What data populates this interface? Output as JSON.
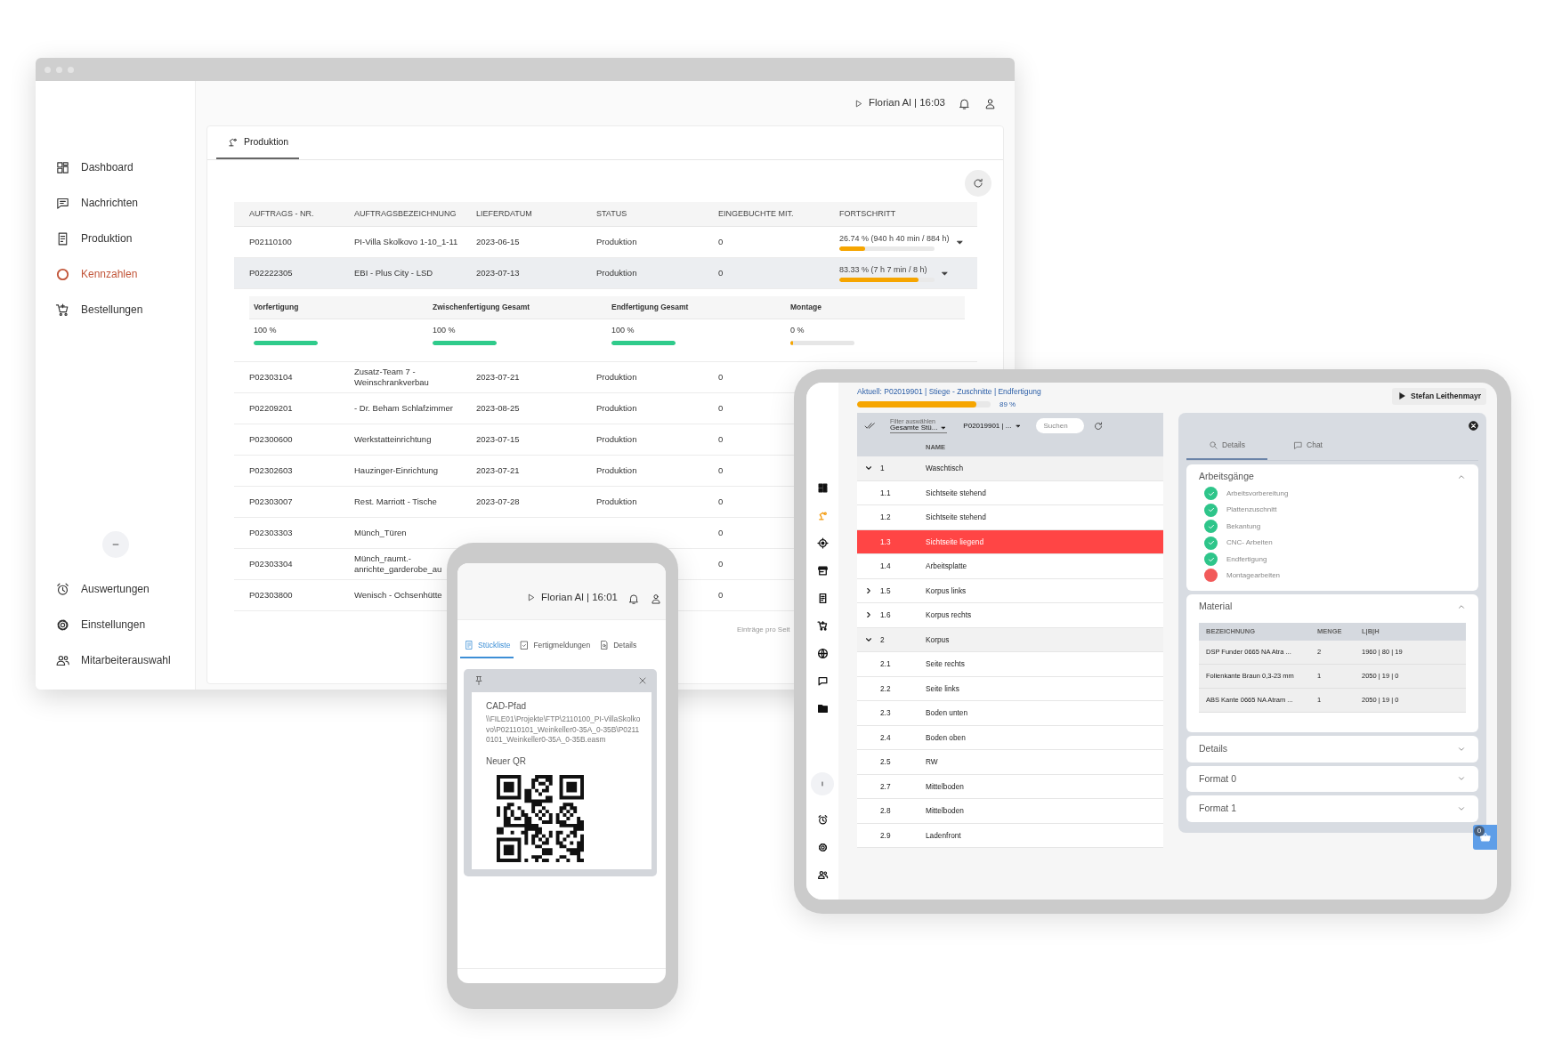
{
  "desktop": {
    "user": "Florian Al | 16:03",
    "nav": [
      {
        "label": "Dashboard",
        "selected": false
      },
      {
        "label": "Nachrichten",
        "selected": false
      },
      {
        "label": "Produktion",
        "selected": false
      },
      {
        "label": "Kennzahlen",
        "selected": true
      },
      {
        "label": "Bestellungen",
        "selected": false
      }
    ],
    "nav_bottom": [
      {
        "label": "Auswertungen",
        "selected": false
      },
      {
        "label": "Einstellungen",
        "selected": false
      },
      {
        "label": "Mitarbeiterauswahl",
        "selected": false
      }
    ],
    "tabs": [
      {
        "label": "Produktion",
        "selected": true
      }
    ],
    "table": {
      "columns": [
        "AUFTRAGS - NR.",
        "AUFTRAGSBEZEICHNUNG",
        "LIEFERDATUM",
        "STATUS",
        "EINGEBUCHTE MIT.",
        "FORTSCHRITT"
      ],
      "rows": [
        {
          "number": "P02110100",
          "name": "PI-Villa Skolkovo 1-10_1-11",
          "date": "2023-06-15",
          "status": "Produktion",
          "booked": "0",
          "progress": {
            "text": "26.74 % (940 h 40 min / 884 h)",
            "level": 0.27
          }
        },
        {
          "number": "P02222305",
          "name": "EBI - Plus City - LSD",
          "date": "2023-07-13",
          "status": "Produktion",
          "booked": "0",
          "progress": {
            "text": "83.33 % (7 h 7 min / 8 h)",
            "level": 0.83
          },
          "breakdown": [
            {
              "label": "Vorfertigung",
              "reading": "100 %",
              "level": 1
            },
            {
              "label": "Zwischenfertigung Gesamt",
              "reading": "100 %",
              "level": 1
            },
            {
              "label": "Endfertigung Gesamt",
              "reading": "100 %",
              "level": 1
            },
            {
              "label": "Montage",
              "reading": "0 %",
              "level": 0
            }
          ]
        },
        {
          "number": "P02303104",
          "name": "Zusatz-Team 7 - Weinschrankverbau",
          "date": "2023-07-21",
          "status": "Produktion",
          "booked": "0"
        },
        {
          "number": "P02209201",
          "name": "- Dr. Beham Schlafzimmer",
          "date": "2023-08-25",
          "status": "Produktion",
          "booked": "0"
        },
        {
          "number": "P02300600",
          "name": "Werkstatteinrichtung",
          "date": "2023-07-15",
          "status": "Produktion",
          "booked": "0"
        },
        {
          "number": "P02302603",
          "name": "Hauzinger-Einrichtung",
          "date": "2023-07-21",
          "status": "Produktion",
          "booked": "0"
        },
        {
          "number": "P02303007",
          "name": "Rest. Marriott - Tische",
          "date": "2023-07-28",
          "status": "Produktion",
          "booked": "0"
        },
        {
          "number": "P02303303",
          "name": "Münch_Türen",
          "booked": "0"
        },
        {
          "number": "P02303304",
          "name": "Münch_raumt.-anrichte_garderobe_au",
          "booked": "0"
        },
        {
          "number": "P02303800",
          "name": "Wenisch - Ochsenhütte",
          "booked": "0"
        }
      ],
      "footer": "Einträge pro Seit"
    }
  },
  "tablet": {
    "current": {
      "text": "Aktuell: P02019901 | Stiege - Zuschnitte | Endfertigung",
      "level": 0.89,
      "reading": "89 %"
    },
    "user": "Stefan Leithenmayr",
    "rail": [
      {
        "selected": false
      },
      {
        "selected": true
      },
      {
        "selected": false
      },
      {
        "selected": false
      },
      {
        "selected": false
      },
      {
        "selected": false
      },
      {
        "selected": false
      },
      {
        "selected": false
      },
      {
        "selected": false
      }
    ],
    "toolbar": {
      "filter_label": "Filter auswählen",
      "filter_value": "Gesamte Stü...",
      "order": "P02019901 | ...",
      "search_placeholder": "Suchen"
    },
    "tree": {
      "column": "NAME",
      "items": [
        {
          "kind": "group",
          "number": "1",
          "name": "Waschtisch",
          "expanded": true,
          "selected": false,
          "children": [
            {
              "kind": "leaf",
              "number": "1.1",
              "name": "Sichtseite stehend",
              "selected": false
            },
            {
              "kind": "leaf",
              "number": "1.2",
              "name": "Sichtseite stehend",
              "selected": false
            },
            {
              "kind": "leaf",
              "number": "1.3",
              "name": "Sichtseite liegend",
              "selected": true
            },
            {
              "kind": "leaf",
              "number": "1.4",
              "name": "Arbeitsplatte",
              "selected": false
            },
            {
              "kind": "group",
              "number": "1.5",
              "name": "Korpus links",
              "expanded": false,
              "selected": false
            },
            {
              "kind": "group",
              "number": "1.6",
              "name": "Korpus rechts",
              "expanded": false,
              "selected": false
            }
          ]
        },
        {
          "kind": "group",
          "number": "2",
          "name": "Korpus",
          "expanded": true,
          "selected": false,
          "children": [
            {
              "kind": "leaf",
              "number": "2.1",
              "name": "Seite rechts",
              "selected": false
            },
            {
              "kind": "leaf",
              "number": "2.2",
              "name": "Seite links",
              "selected": false
            },
            {
              "kind": "leaf",
              "number": "2.3",
              "name": "Boden unten",
              "selected": false
            },
            {
              "kind": "leaf",
              "number": "2.4",
              "name": "Boden oben",
              "selected": false
            },
            {
              "kind": "leaf",
              "number": "2.5",
              "name": "RW",
              "selected": false
            },
            {
              "kind": "leaf",
              "number": "2.7",
              "name": "Mittelboden",
              "selected": false
            },
            {
              "kind": "leaf",
              "number": "2.8",
              "name": "Mittelboden",
              "selected": false
            },
            {
              "kind": "leaf",
              "number": "2.9",
              "name": "Ladenfront",
              "selected": false
            }
          ]
        }
      ]
    },
    "details": {
      "tabs": [
        {
          "label": "Details",
          "selected": true
        },
        {
          "label": "Chat",
          "selected": false
        }
      ],
      "sections": [
        {
          "title": "Arbeitsgänge",
          "expanded": true,
          "steps": [
            {
              "label": "Arbeitsvorbereitung",
              "done": true
            },
            {
              "label": "Plattenzuschnitt",
              "done": true
            },
            {
              "label": "Bekantung",
              "done": true
            },
            {
              "label": "CNC- Arbeiten",
              "done": true
            },
            {
              "label": "Endfertigung",
              "done": true
            },
            {
              "label": "Montagearbeiten",
              "done": false
            }
          ]
        },
        {
          "title": "Material",
          "expanded": true,
          "columns": [
            "BEZEICHNUNG",
            "MENGE",
            "L|B|H"
          ],
          "rows": [
            [
              "DSP Funder 0665 NA Atra ...",
              "2",
              "1960 | 80 | 19"
            ],
            [
              "Folienkante Braun 0,3-23 mm",
              "1",
              "2050 | 19 | 0"
            ],
            [
              "ABS Kante 0665 NA Atram ...",
              "1",
              "2050 | 19 | 0"
            ]
          ]
        },
        {
          "title": "Details",
          "expanded": false
        },
        {
          "title": "Format 0",
          "expanded": false
        },
        {
          "title": "Format 1",
          "expanded": false
        }
      ]
    },
    "cart": {
      "count": "0"
    }
  },
  "phone": {
    "user": "Florian Al | 16:01",
    "tabs": [
      {
        "label": "Stückliste",
        "selected": true
      },
      {
        "label": "Fertigmeldungen",
        "selected": false
      },
      {
        "label": "Details",
        "selected": false
      }
    ],
    "card": {
      "title": "CAD-Pfad",
      "path": "\\\\FILE01\\Projekte\\FTP\\2110100_PI-VillaSkolkovo\\P02110101_Weinkeller0-35A_0-35B\\P02110101_Weinkeller0-35A_0-35B.easm",
      "qr_label": "Neuer QR"
    }
  }
}
